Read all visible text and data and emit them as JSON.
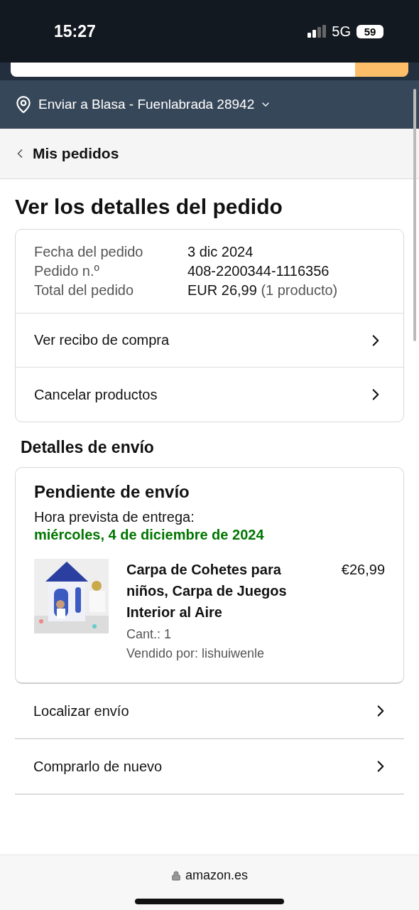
{
  "status_bar": {
    "time": "15:27",
    "network": "5G",
    "battery": "59"
  },
  "location": {
    "label": "Enviar a Blasa - Fuenlabrada 28942"
  },
  "back_link": {
    "label": "Mis pedidos"
  },
  "title": "Ver los detalles del pedido",
  "order_summary": {
    "rows": [
      {
        "label": "Fecha del pedido",
        "value": "3 dic 2024",
        "note": ""
      },
      {
        "label": "Pedido n.º",
        "value": "408-2200344-1116356",
        "note": ""
      },
      {
        "label": "Total del pedido",
        "value": "EUR 26,99",
        "note": "(1 producto)"
      }
    ],
    "actions": [
      "Ver recibo de compra",
      "Cancelar productos"
    ]
  },
  "shipping": {
    "heading": "Detalles de envío",
    "status": "Pendiente de envío",
    "delivery_label": "Hora prevista de entrega:",
    "delivery_date": "miércoles, 4 de diciembre de 2024",
    "item": {
      "kind": "picture",
      "name": "Carpa de Cohetes para niños, Carpa de Juegos Interior al Aire",
      "quantity": "Cant.: 1",
      "seller": "Vendido por: lishuiwenle",
      "price": "€26,99"
    },
    "actions": [
      "Localizar envío",
      "Comprarlo de nuevo"
    ]
  },
  "browser_bar": {
    "url": "amazon.es"
  }
}
